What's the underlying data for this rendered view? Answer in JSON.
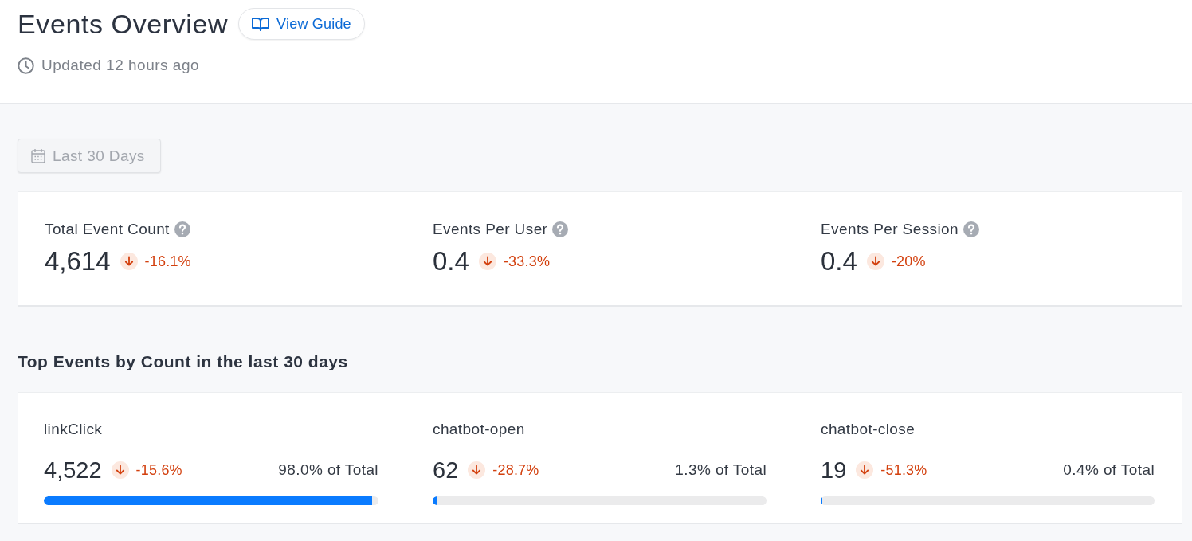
{
  "header": {
    "title": "Events Overview",
    "guide_button": "View Guide",
    "updated": "Updated 12 hours ago"
  },
  "date_range": {
    "label": "Last 30 Days",
    "disabled": true
  },
  "metrics": [
    {
      "label": "Total Event Count",
      "value": "4,614",
      "decrease": true,
      "change": "-16.1%"
    },
    {
      "label": "Events Per User",
      "value": "0.4",
      "decrease": true,
      "change": "-33.3%"
    },
    {
      "label": "Events Per Session",
      "value": "0.4",
      "decrease": true,
      "change": "-20%"
    }
  ],
  "top_events": {
    "title": "Top Events by Count in the last 30 days",
    "events": [
      {
        "name": "linkClick",
        "value": "4,522",
        "decrease": true,
        "change": "-15.6%",
        "share": "98.0% of Total",
        "level": 0.98
      },
      {
        "name": "chatbot-open",
        "value": "62",
        "decrease": true,
        "change": "-28.7%",
        "share": "1.3% of Total",
        "level": 0.013
      },
      {
        "name": "chatbot-close",
        "value": "19",
        "decrease": true,
        "change": "-51.3%",
        "share": "0.4% of Total",
        "level": 0.004
      }
    ]
  }
}
